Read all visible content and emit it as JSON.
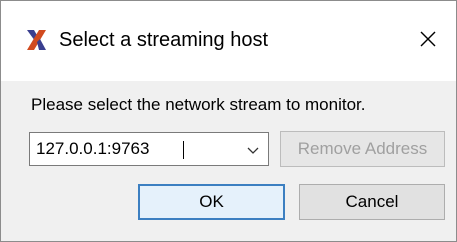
{
  "window": {
    "title": "Select a streaming host",
    "close_glyph": "✕",
    "icon": "x-logo-icon",
    "accent_color": "#d14a1f",
    "accent_color_dark": "#3a3f8f"
  },
  "content": {
    "prompt": "Please select the network stream to monitor."
  },
  "host_select": {
    "value": "127.0.0.1:9763",
    "arrow_icon": "chevron-down-icon"
  },
  "buttons": {
    "remove_address": "Remove Address",
    "ok": "OK",
    "cancel": "Cancel"
  }
}
